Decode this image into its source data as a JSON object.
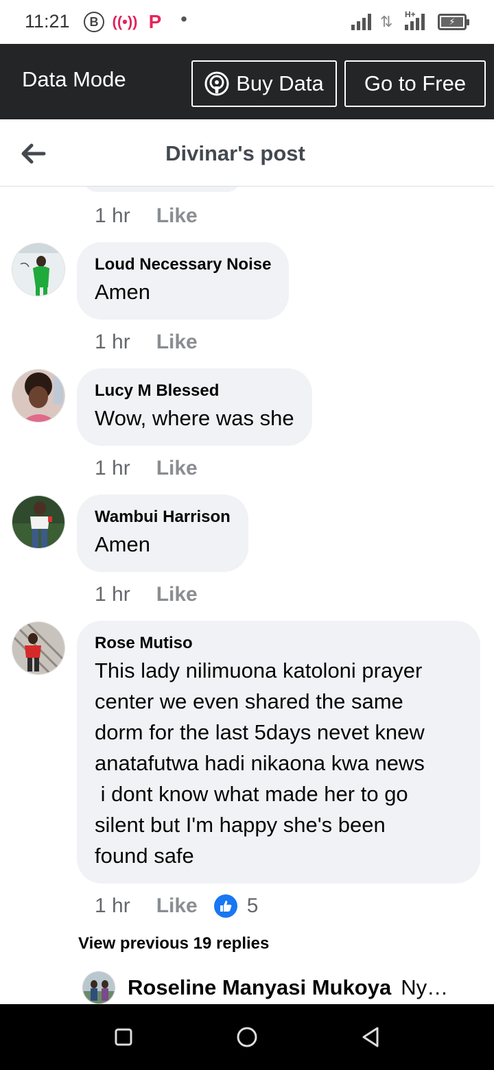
{
  "status_bar": {
    "time": "11:21",
    "icons": [
      "b-badge-icon",
      "recording-icon",
      "p-app-icon",
      "dot-icon",
      "signal-icon",
      "data-arrows-icon",
      "h-plus-signal-icon",
      "battery-charging-icon"
    ],
    "hplus_label": "H+"
  },
  "data_bar": {
    "title": "Data Mode",
    "buy_label": "Buy Data",
    "free_label": "Go to Free"
  },
  "header": {
    "title": "Divinar's post"
  },
  "first_meta": {
    "time": "1 hr",
    "like": "Like"
  },
  "comments": [
    {
      "author": "Loud Necessary Noise",
      "text": "Amen",
      "time": "1 hr",
      "like": "Like"
    },
    {
      "author": "Lucy M Blessed",
      "text": "Wow, where was she",
      "time": "1 hr",
      "like": "Like"
    },
    {
      "author": "Wambui Harrison",
      "text": "Amen",
      "time": "1 hr",
      "like": "Like"
    },
    {
      "author": "Rose Mutiso",
      "text": "This lady nilimuona katoloni prayer\ncenter we even shared the same\ndorm for the last 5days nevet knew\nanatafutwa hadi nikaona kwa news\n i dont know what made her to go\nsilent but I'm happy she's been\nfound safe",
      "time": "1 hr",
      "like": "Like",
      "reaction_count": "5"
    }
  ],
  "view_previous": "View previous 19 replies",
  "next_reply": {
    "author": "Roseline Manyasi Mukoya",
    "snippet": "Ny…"
  },
  "colors": {
    "data_bar_bg": "#242526",
    "bubble_bg": "#f0f2f5",
    "like_blue": "#1877f2",
    "meta_gray": "#65676b"
  }
}
